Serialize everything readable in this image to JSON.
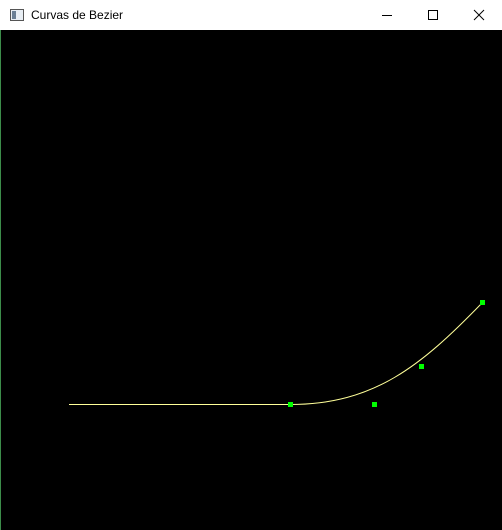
{
  "window": {
    "title": "Curvas de Bezier",
    "icon": "app-window-icon",
    "controls": [
      "minimize-icon",
      "maximize-icon",
      "close-icon"
    ]
  },
  "scene": {
    "background_color": "#000000",
    "curve_color": "#ffff99",
    "control_point_color": "#00ff00",
    "line_segment_color": "#ffff99"
  }
}
